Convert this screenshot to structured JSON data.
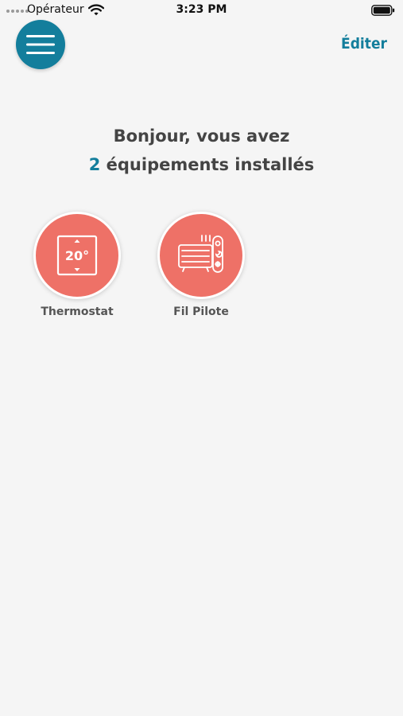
{
  "status_bar": {
    "carrier": "Opérateur",
    "time": "3:23 PM"
  },
  "header": {
    "edit_label": "Éditer"
  },
  "greeting": {
    "line1": "Bonjour, vous avez",
    "count": "2",
    "line2_suffix": "équipements installés"
  },
  "devices": [
    {
      "label": "Thermostat",
      "display_value": "20°",
      "icon": "thermostat-icon"
    },
    {
      "label": "Fil Pilote",
      "icon": "radiator-icon"
    }
  ],
  "colors": {
    "accent": "#137e9c",
    "device_circle": "#ee7167",
    "background": "#f5f5f5",
    "text": "#444444"
  }
}
